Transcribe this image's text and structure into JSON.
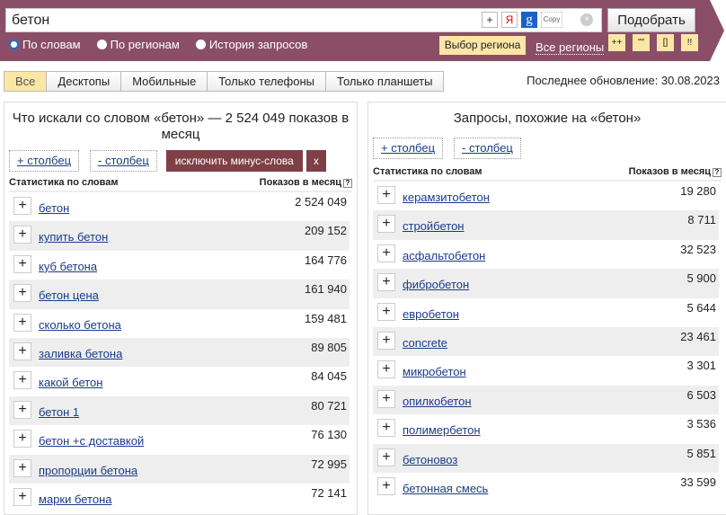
{
  "search": {
    "value": "бетон",
    "submit": "Подобрать",
    "icons": [
      "plus-icon",
      "yandex-icon",
      "google-icon",
      "copy-icon",
      "clear-icon"
    ],
    "copy_label": "Copy",
    "plus": "+",
    "yandex": "Я",
    "google": "g",
    "clear": "×"
  },
  "modes": [
    {
      "label": "По словам",
      "selected": true
    },
    {
      "label": "По регионам",
      "selected": false
    },
    {
      "label": "История запросов",
      "selected": false
    }
  ],
  "region": {
    "button": "Выбор региона",
    "current": "Все регионы"
  },
  "operators": [
    "++",
    "\"\"",
    "[]",
    "!!"
  ],
  "device_tabs": [
    {
      "label": "Все",
      "active": true
    },
    {
      "label": "Десктопы"
    },
    {
      "label": "Мобильные"
    },
    {
      "label": "Только телефоны"
    },
    {
      "label": "Только планшеты"
    }
  ],
  "last_update": "Последнее обновление: 30.08.2023",
  "left": {
    "title": "Что искали со словом «бетон» — 2 524 049 показов в месяц",
    "add_col": "+ столбец",
    "rm_col": "- столбец",
    "exclude": "исключить минус-слова",
    "close": "x",
    "col1": "Статистика по словам",
    "col2": "Показов в месяц",
    "help": "?",
    "rows": [
      [
        "бетон",
        "2 524 049"
      ],
      [
        "купить бетон",
        "209 152"
      ],
      [
        "куб бетона",
        "164 776"
      ],
      [
        "бетон цена",
        "161 940"
      ],
      [
        "сколько бетона",
        "159 481"
      ],
      [
        "заливка бетона",
        "89 805"
      ],
      [
        "какой бетон",
        "84 045"
      ],
      [
        "бетон 1",
        "80 721"
      ],
      [
        "бетон +с доставкой",
        "76 130"
      ],
      [
        "пропорции бетона",
        "72 995"
      ],
      [
        "марки бетона",
        "72 141"
      ]
    ]
  },
  "right": {
    "title": "Запросы, похожие на «бетон»",
    "add_col": "+ столбец",
    "rm_col": "- столбец",
    "col1": "Статистика по словам",
    "col2": "Показов в месяц",
    "help": "?",
    "rows": [
      [
        "керамзитобетон",
        "19 280"
      ],
      [
        "стройбетон",
        "8 711"
      ],
      [
        "асфальтобетон",
        "32 523"
      ],
      [
        "фибробетон",
        "5 900"
      ],
      [
        "евробетон",
        "5 644"
      ],
      [
        "concrete",
        "23 461"
      ],
      [
        "микробетон",
        "3 301"
      ],
      [
        "опилкобетон",
        "6 503"
      ],
      [
        "полимербетон",
        "3 536"
      ],
      [
        "бетоновоз",
        "5 851"
      ],
      [
        "бетонная смесь",
        "33 599"
      ]
    ]
  },
  "row_plus": "+"
}
